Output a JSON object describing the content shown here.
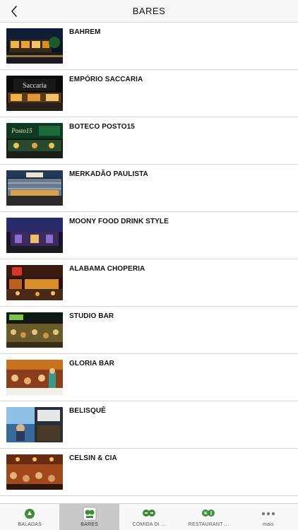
{
  "nav": {
    "title": "BARES",
    "back_icon": "chevron-left-icon"
  },
  "bars": [
    {
      "name": "BAHREM",
      "photo": "bahrem-photo"
    },
    {
      "name": "EMPÓRIO SACCARIA",
      "photo": "emporio-saccaria-photo",
      "sign_text": "Saccaria"
    },
    {
      "name": "BOTECO POSTO15",
      "photo": "boteco-posto15-photo",
      "sign_text": "Posto15"
    },
    {
      "name": "MERKADÃO PAULISTA",
      "photo": "merkadao-paulista-photo"
    },
    {
      "name": "MOONY FOOD DRINK STYLE",
      "photo": "moony-photo"
    },
    {
      "name": "ALABAMA CHOPERIA",
      "photo": "alabama-choperia-photo"
    },
    {
      "name": "STUDIO BAR",
      "photo": "studio-bar-photo"
    },
    {
      "name": "GLORIA BAR",
      "photo": "gloria-bar-photo"
    },
    {
      "name": "BELISQUÊ",
      "photo": "belisque-photo"
    },
    {
      "name": "CELSIN & CIA",
      "photo": "celsin-cia-photo"
    }
  ],
  "tabs": [
    {
      "label": "BALADAS",
      "icon": "baladas-icon",
      "active": false
    },
    {
      "label": "BARES",
      "icon": "bares-icon",
      "active": true
    },
    {
      "label": "COMIDA DI ...",
      "icon": "comida-di-buteco-icon",
      "active": false
    },
    {
      "label": "RESTAURANT ...",
      "icon": "restaurantes-icon",
      "active": false
    },
    {
      "label": "mais",
      "icon": "more-dots-icon",
      "active": false
    }
  ],
  "colors": {
    "brand_green": "#3f8a3c",
    "navbar_bg": "#f7f7f7",
    "tab_active_bg": "#c9c9c9",
    "divider": "#d6d6d6"
  }
}
